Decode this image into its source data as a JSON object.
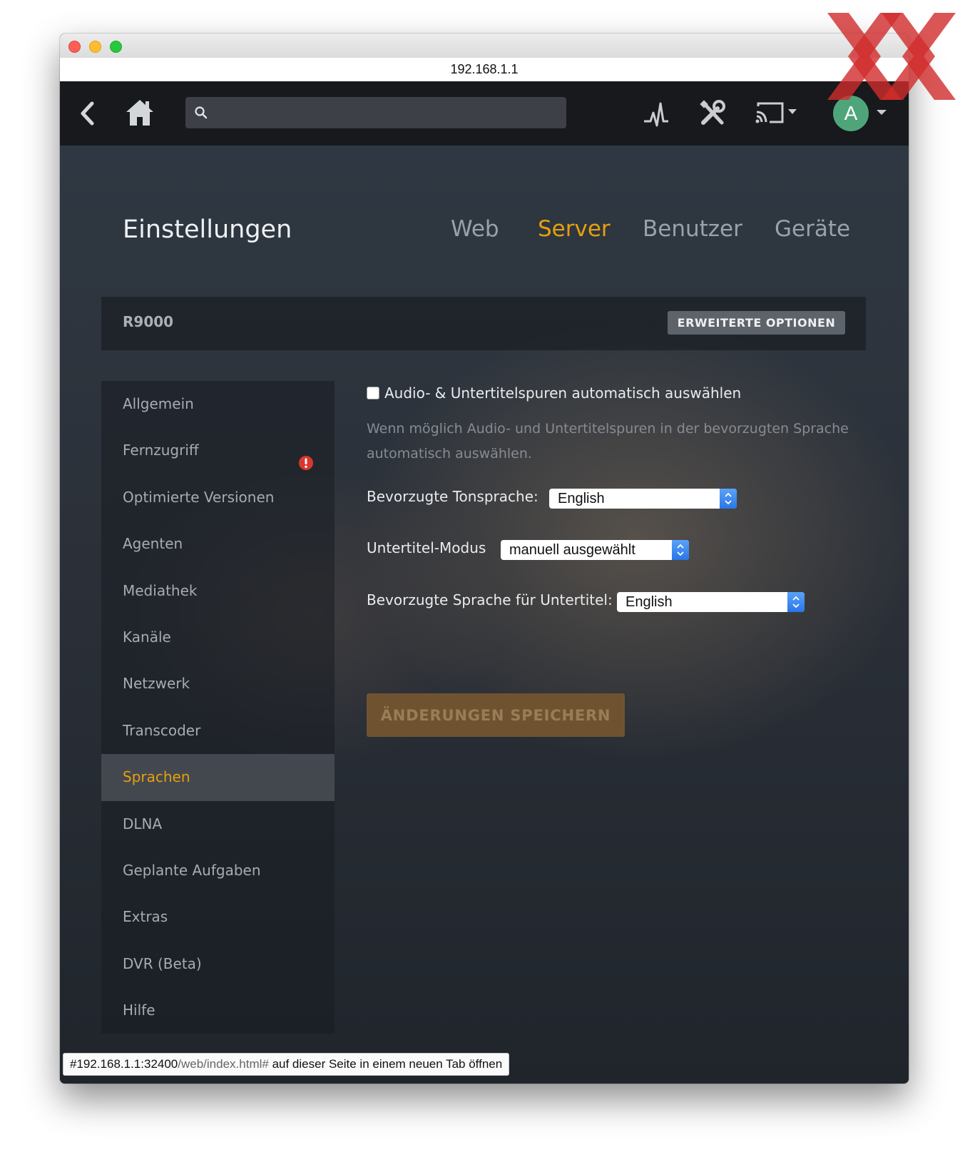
{
  "browser": {
    "url": "192.168.1.1",
    "status": {
      "host": "#192.168.1.1:32400",
      "path": "/web/index.html#",
      "action": "auf dieser Seite in einem neuen Tab öffnen"
    }
  },
  "navbar": {
    "search_value": "",
    "avatar_letter": "A",
    "icons": [
      "back-icon",
      "home-icon",
      "search-icon",
      "activity-icon",
      "tools-icon",
      "cast-icon",
      "chevron-down-icon"
    ]
  },
  "page": {
    "title": "Einstellungen",
    "tabs": [
      {
        "label": "Web",
        "active": false
      },
      {
        "label": "Server",
        "active": true
      },
      {
        "label": "Benutzer",
        "active": false
      },
      {
        "label": "Geräte",
        "active": false
      }
    ]
  },
  "server": {
    "name": "R9000",
    "advanced_label": "ERWEITERTE OPTIONEN"
  },
  "sidebar": {
    "items": [
      {
        "label": "Allgemein"
      },
      {
        "label": "Fernzugriff",
        "warning": true
      },
      {
        "label": "Optimierte Versionen"
      },
      {
        "label": "Agenten"
      },
      {
        "label": "Mediathek"
      },
      {
        "label": "Kanäle"
      },
      {
        "label": "Netzwerk"
      },
      {
        "label": "Transcoder"
      },
      {
        "label": "Sprachen",
        "active": true
      },
      {
        "label": "DLNA"
      },
      {
        "label": "Geplante Aufgaben"
      },
      {
        "label": "Extras"
      },
      {
        "label": "DVR (Beta)"
      },
      {
        "label": "Hilfe"
      }
    ]
  },
  "settings": {
    "auto_select": {
      "label": "Audio- & Untertitelspuren automatisch auswählen",
      "checked": false,
      "help": "Wenn möglich Audio- und Untertitelspuren in der bevorzugten Sprache automatisch auswählen."
    },
    "audio_language": {
      "label": "Bevorzugte Tonsprache:",
      "value": "English"
    },
    "subtitle_mode": {
      "label": "Untertitel-Modus",
      "value": "manuell ausgewählt"
    },
    "subtitle_language": {
      "label": "Bevorzugte Sprache für Untertitel:",
      "value": "English"
    },
    "save_label": "ÄNDERUNGEN SPEICHERN"
  },
  "colors": {
    "accent": "#e5a00d",
    "navbar": "#17191c",
    "avatar": "#4fa57a",
    "warning": "#d9382e",
    "watermark": "#d12c2c"
  }
}
